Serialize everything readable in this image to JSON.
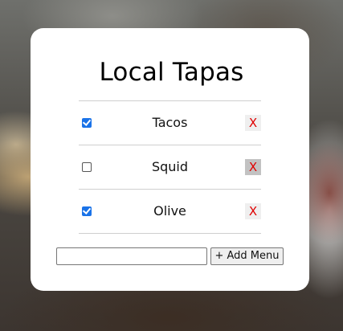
{
  "app": {
    "title": "Local Tapas"
  },
  "menu": {
    "items": [
      {
        "label": "Tacos",
        "checked": true,
        "delete_label": "X"
      },
      {
        "label": "Squid",
        "checked": false,
        "delete_label": "X"
      },
      {
        "label": "Olive",
        "checked": true,
        "delete_label": "X"
      }
    ]
  },
  "add_form": {
    "input_value": "",
    "input_placeholder": "",
    "button_label": "+ Add Menu"
  },
  "colors": {
    "card_background": "#ffffff",
    "checkbox_checked": "#1a73e8",
    "delete_text": "#e00000"
  }
}
